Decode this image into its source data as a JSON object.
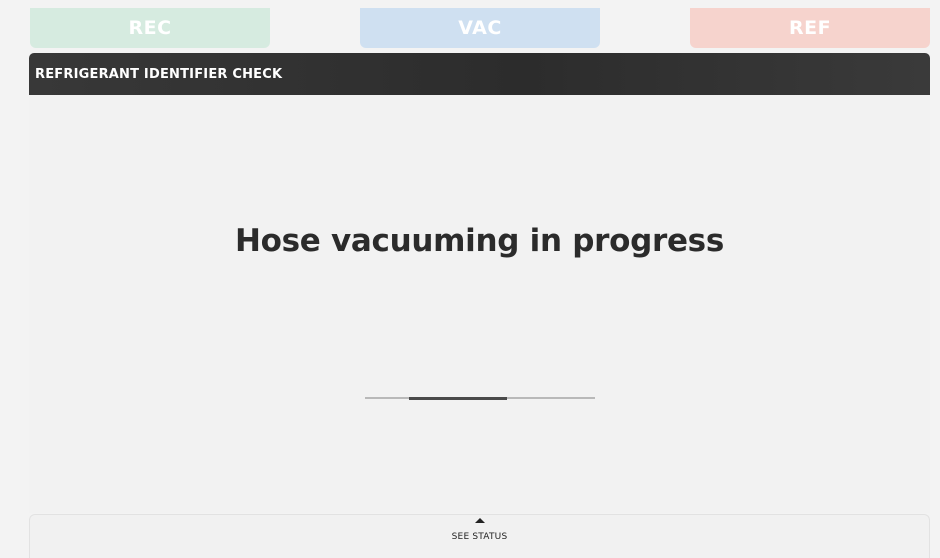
{
  "tabs": {
    "rec": {
      "label": "REC",
      "color": "#d6ebe0"
    },
    "vac": {
      "label": "VAC",
      "color": "#cfe0f1"
    },
    "ref": {
      "label": "REF",
      "color": "#f6d3cd"
    }
  },
  "header": {
    "title": "REFRIGERANT IDENTIFIER CHECK"
  },
  "main": {
    "message": "Hose vacuuming in progress",
    "progress": {
      "state": "indeterminate"
    }
  },
  "status_bar": {
    "icon": "caret-up-icon",
    "label": "SEE STATUS"
  }
}
